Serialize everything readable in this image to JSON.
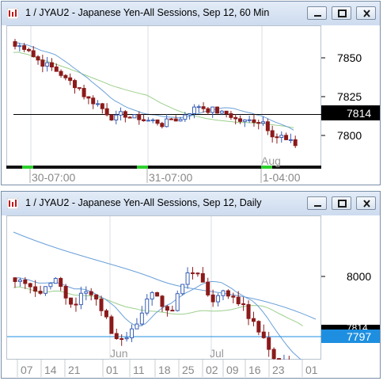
{
  "windows": [
    {
      "title": "1 / JYAU2 - Japanese Yen-All Sessions, Sep 12, 60 Min",
      "price_labels": [
        "7850",
        "7825",
        "7800"
      ],
      "last_price_tag": "7814",
      "time_labels": [
        "30-07:00",
        "31-07:00",
        "1-04:00"
      ],
      "month_label": "Aug"
    },
    {
      "title": "1 / JYAU2 - Japanese Yen-All Sessions, Sep 12, Daily",
      "price_labels": [
        "8000"
      ],
      "last_price_tag": "7797",
      "hidden_tag": "7814",
      "day_labels": [
        "07",
        "14",
        "21",
        "01",
        "11",
        "18",
        "25",
        "02",
        "09",
        "16",
        "23",
        "01"
      ],
      "month_labels": [
        "Jun",
        "Jul"
      ]
    }
  ],
  "colors": {
    "up_candle": "#3a5fb5",
    "down_candle": "#8b1a1a",
    "ma_fast": "#6aa0d8",
    "ma_slow": "#9ccf8c",
    "price_line_top": "#000000",
    "price_line_bottom": "#1e8fe0",
    "tag_bg_top": "#000000",
    "tag_bg_bottom": "#1e8fe0"
  }
}
